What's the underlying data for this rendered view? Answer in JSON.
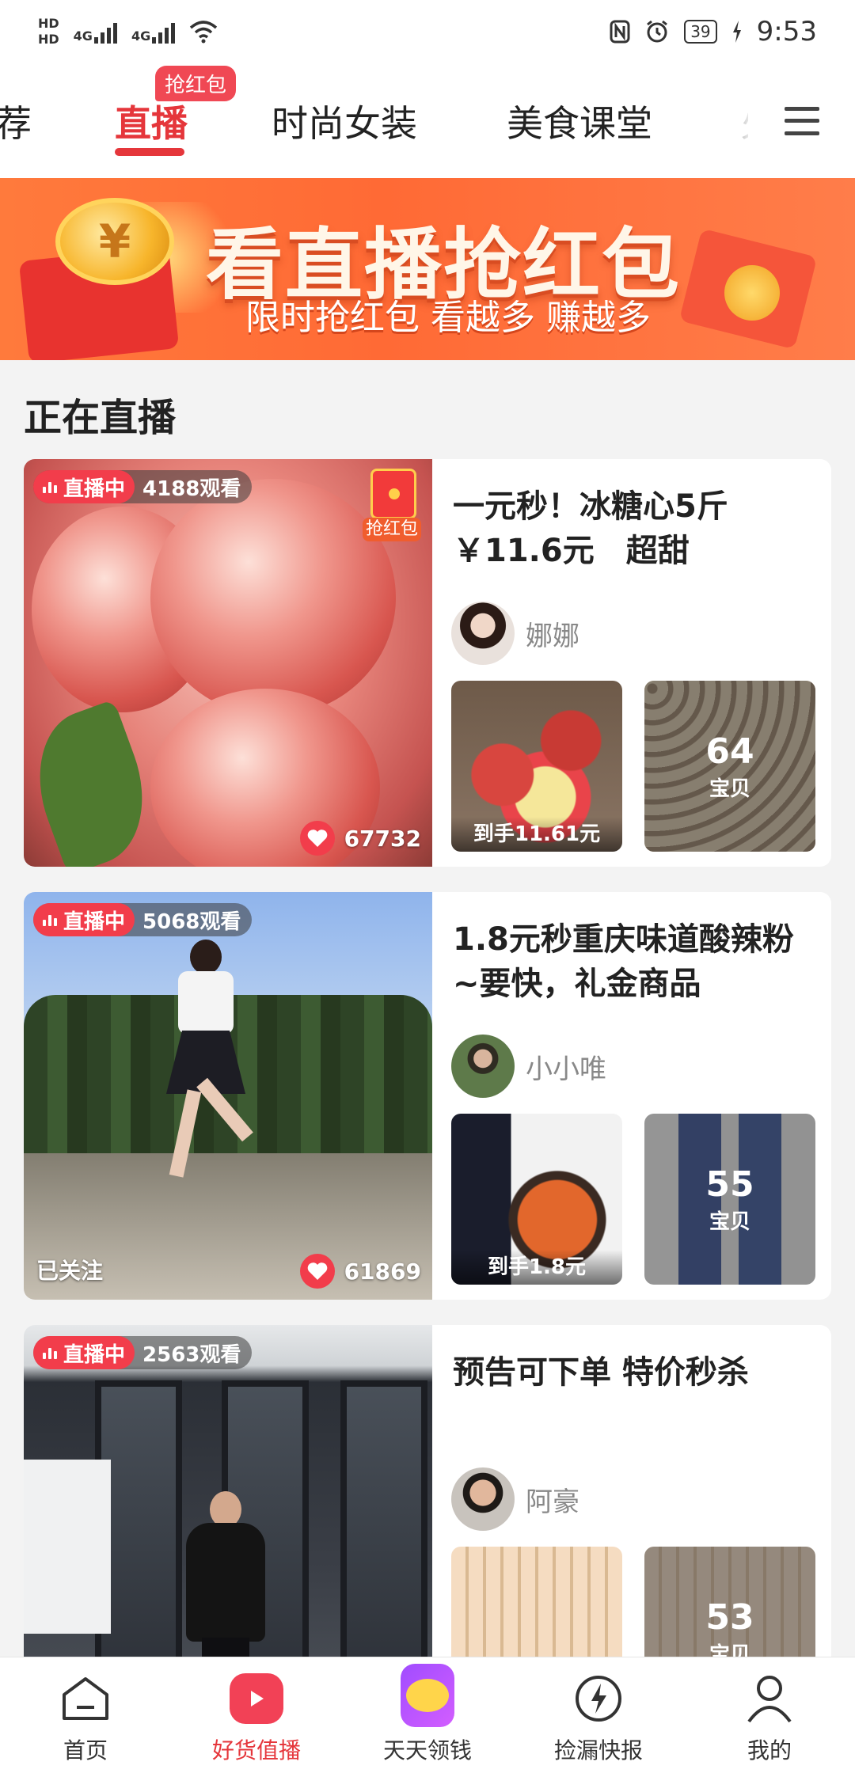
{
  "status_bar": {
    "hd1": "HD",
    "hd2": "HD",
    "net1": "4G",
    "net2": "4G",
    "battery": "39",
    "time": "9:53"
  },
  "tabs": [
    {
      "label": "荐",
      "active": false
    },
    {
      "label": "直播",
      "active": true
    },
    {
      "label": "时尚女装",
      "active": false
    },
    {
      "label": "美食课堂",
      "active": false
    },
    {
      "label": "火",
      "active": false
    }
  ],
  "tab_badge": "抢红包",
  "banner": {
    "title": "看直播抢红包",
    "subtitle": "限时抢红包 看越多 赚越多"
  },
  "section_title": "正在直播",
  "cards": [
    {
      "live_label": "直播中",
      "viewers": "4188观看",
      "redpack_label": "抢红包",
      "likes": "67732",
      "title": "一元秒！冰糖心5斤 ￥11.6元　超甜",
      "author": "娜娜",
      "thumb1_caption": "到手11.61元",
      "thumb2_count": "64",
      "thumb2_label": "宝贝"
    },
    {
      "live_label": "直播中",
      "viewers": "5068观看",
      "followed": "已关注",
      "likes": "61869",
      "title": "1.8元秒重庆味道酸辣粉~要快，礼金商品",
      "author": "小小唯",
      "thumb1_caption": "到手1.8元",
      "thumb2_count": "55",
      "thumb2_label": "宝贝"
    },
    {
      "live_label": "直播中",
      "viewers": "2563观看",
      "title": "预告可下单 特价秒杀",
      "author": "阿豪",
      "thumb2_count": "53",
      "thumb2_label": "宝贝"
    }
  ],
  "bottom_nav": [
    {
      "label": "首页",
      "icon": "home-icon"
    },
    {
      "label": "好货值播",
      "icon": "live-play-icon",
      "active": true
    },
    {
      "label": "天天领钱",
      "icon": "cat-coin-icon"
    },
    {
      "label": "捡漏快报",
      "icon": "lightning-icon"
    },
    {
      "label": "我的",
      "icon": "person-icon"
    }
  ],
  "colors": {
    "accent": "#e5363b",
    "live_tag": "#f23d4b",
    "banner": "#ff6a35",
    "page_bg": "#f3f3f3"
  }
}
